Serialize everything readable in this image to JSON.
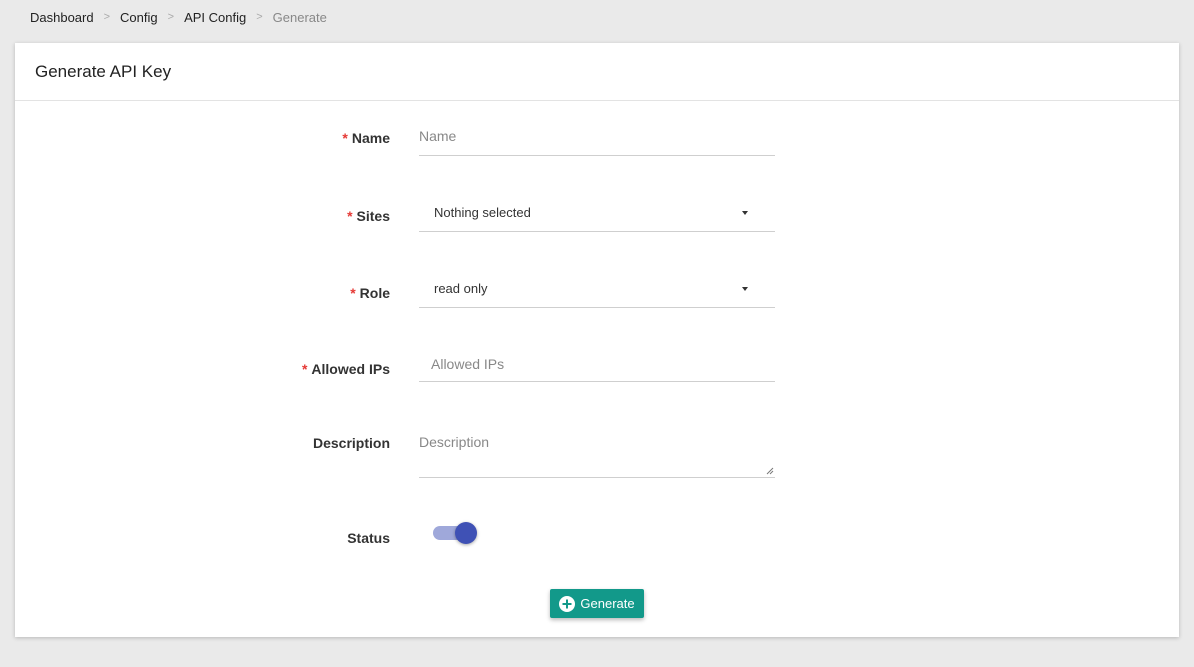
{
  "breadcrumb": {
    "items": [
      "Dashboard",
      "Config",
      "API Config"
    ],
    "current": "Generate",
    "separator": ">"
  },
  "card": {
    "title": "Generate API Key"
  },
  "form": {
    "required_mark": "*",
    "name": {
      "label": "Name",
      "placeholder": "Name",
      "value": ""
    },
    "sites": {
      "label": "Sites",
      "value": "Nothing selected"
    },
    "role": {
      "label": "Role",
      "value": "read only"
    },
    "allowed_ips": {
      "label": "Allowed IPs",
      "placeholder": "Allowed IPs",
      "value": ""
    },
    "description": {
      "label": "Description",
      "placeholder": "Description",
      "value": ""
    },
    "status": {
      "label": "Status",
      "enabled": true
    }
  },
  "actions": {
    "generate_label": "Generate"
  },
  "colors": {
    "primary": "#12998a",
    "required": "#e53935",
    "toggle_on": "#3f51b5",
    "toggle_track": "#9fa8da"
  },
  "icons": {
    "generate": "plus-circle-icon",
    "dropdown": "caret-down-icon"
  }
}
